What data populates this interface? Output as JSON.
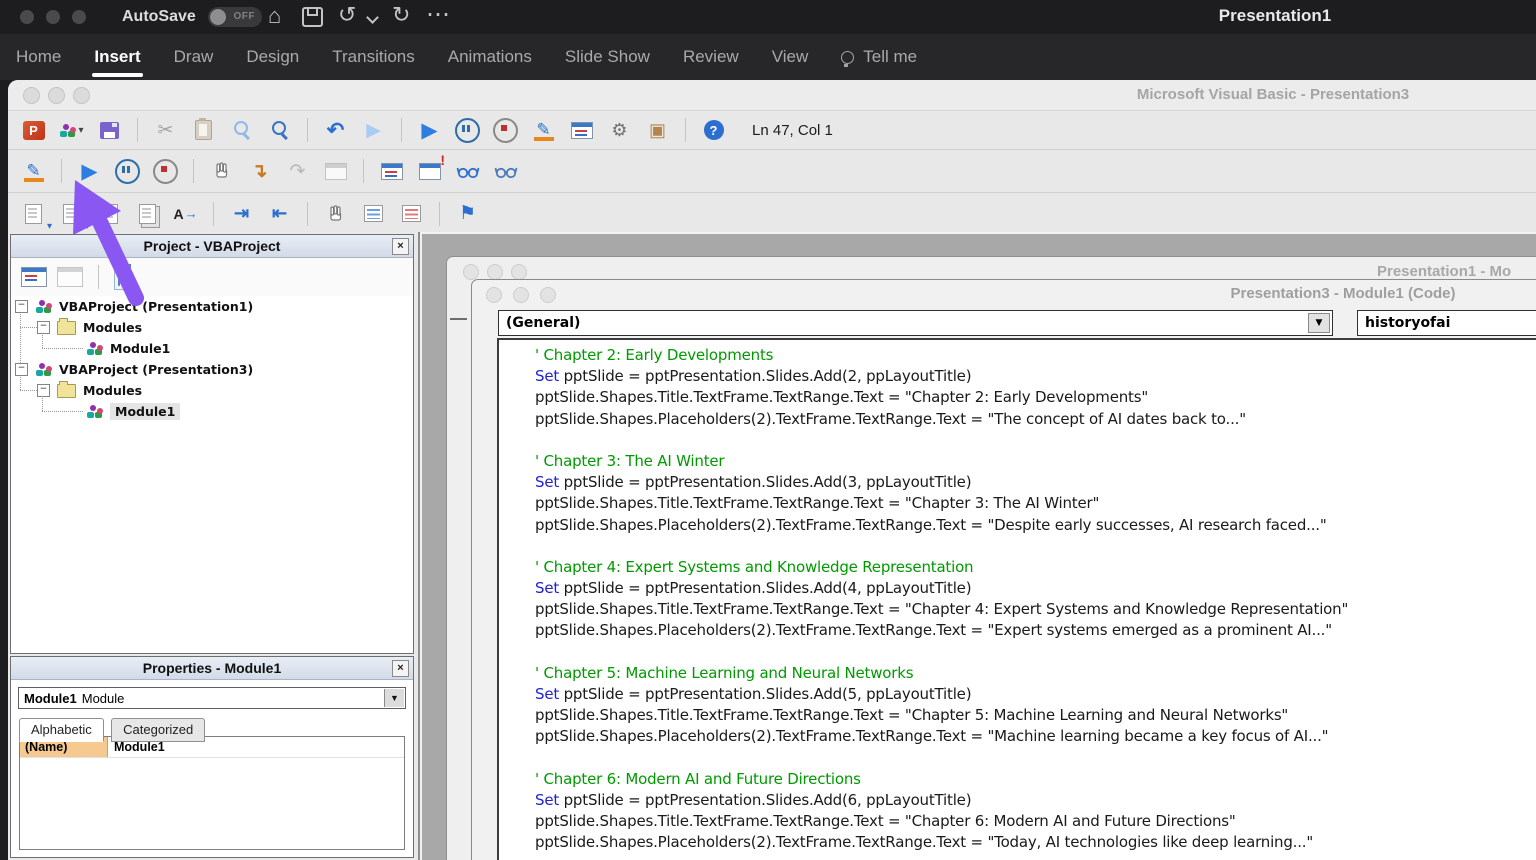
{
  "macos_bar": {
    "autosave_label": "AutoSave",
    "autosave_state": "OFF",
    "window_title": "Presentation1"
  },
  "ribbon": {
    "tabs": [
      {
        "label": "Home"
      },
      {
        "label": "Insert"
      },
      {
        "label": "Draw"
      },
      {
        "label": "Design"
      },
      {
        "label": "Transitions"
      },
      {
        "label": "Animations"
      },
      {
        "label": "Slide Show"
      },
      {
        "label": "Review"
      },
      {
        "label": "View"
      }
    ],
    "active_tab": "Insert",
    "tell_me_label": "Tell me"
  },
  "vba_window": {
    "title": "Microsoft Visual Basic - Presentation3",
    "line_col_indicator": "Ln 47, Col 1"
  },
  "project_panel": {
    "title": "Project - VBAProject",
    "tree": [
      {
        "label": "VBAProject (Presentation1)",
        "type": "project",
        "level": 0,
        "expanded": true
      },
      {
        "label": "Modules",
        "type": "folder",
        "level": 1,
        "expanded": true
      },
      {
        "label": "Module1",
        "type": "module",
        "level": 2
      },
      {
        "label": "VBAProject (Presentation3)",
        "type": "project",
        "level": 0,
        "expanded": true
      },
      {
        "label": "Modules",
        "type": "folder",
        "level": 1,
        "expanded": true
      },
      {
        "label": "Module1",
        "type": "module",
        "level": 2,
        "selected": true
      }
    ]
  },
  "properties_panel": {
    "title": "Properties - Module1",
    "selected_object": "Module1",
    "selected_object_type": "Module",
    "tabs": [
      {
        "label": "Alphabetic",
        "active": true
      },
      {
        "label": "Categorized",
        "active": false
      }
    ],
    "rows": [
      {
        "key": "(Name)",
        "value": "Module1"
      }
    ]
  },
  "code_window": {
    "back_window_title": "Presentation1 - Mo",
    "front_window_title": "Presentation3 - Module1 (Code)",
    "object_dropdown": "(General)",
    "procedure_dropdown": "historyofai"
  },
  "code": {
    "keyword": "Set",
    "blocks": [
      {
        "comment": "' Chapter 2: Early Developments",
        "set_rest": " pptSlide = pptPresentation.Slides.Add(2, ppLayoutTitle)",
        "title_line": "pptSlide.Shapes.Title.TextFrame.TextRange.Text = \"Chapter 2: Early Developments\"",
        "body_line": "pptSlide.Shapes.Placeholders(2).TextFrame.TextRange.Text = \"The concept of AI dates back to...\""
      },
      {
        "comment": "' Chapter 3: The AI Winter",
        "set_rest": " pptSlide = pptPresentation.Slides.Add(3, ppLayoutTitle)",
        "title_line": "pptSlide.Shapes.Title.TextFrame.TextRange.Text = \"Chapter 3: The AI Winter\"",
        "body_line": "pptSlide.Shapes.Placeholders(2).TextFrame.TextRange.Text = \"Despite early successes, AI research faced...\""
      },
      {
        "comment": "' Chapter 4: Expert Systems and Knowledge Representation",
        "set_rest": " pptSlide = pptPresentation.Slides.Add(4, ppLayoutTitle)",
        "title_line": "pptSlide.Shapes.Title.TextFrame.TextRange.Text = \"Chapter 4: Expert Systems and Knowledge Representation\"",
        "body_line": "pptSlide.Shapes.Placeholders(2).TextFrame.TextRange.Text = \"Expert systems emerged as a prominent AI...\""
      },
      {
        "comment": "' Chapter 5: Machine Learning and Neural Networks",
        "set_rest": " pptSlide = pptPresentation.Slides.Add(5, ppLayoutTitle)",
        "title_line": "pptSlide.Shapes.Title.TextFrame.TextRange.Text = \"Chapter 5: Machine Learning and Neural Networks\"",
        "body_line": "pptSlide.Shapes.Placeholders(2).TextFrame.TextRange.Text = \"Machine learning became a key focus of AI...\""
      },
      {
        "comment": "' Chapter 6: Modern AI and Future Directions",
        "set_rest": " pptSlide = pptPresentation.Slides.Add(6, ppLayoutTitle)",
        "title_line": "pptSlide.Shapes.Title.TextFrame.TextRange.Text = \"Chapter 6: Modern AI and Future Directions\"",
        "body_line": "pptSlide.Shapes.Placeholders(2).TextFrame.TextRange.Text = \"Today, AI technologies like deep learning...\""
      }
    ]
  },
  "annotation_arrow": {
    "color": "#8a57f2"
  },
  "colors": {
    "comment_green": "#009a00",
    "keyword_blue": "#2222cc",
    "run_blue": "#2e7de0",
    "accent_blue": "#2d6fd1"
  },
  "icons": {
    "home": "⌂",
    "undo_mac": "↺",
    "redo_mac": "↻",
    "ellipsis": "⋯",
    "cut": "✂",
    "undo": "↶",
    "redo_ghost": "▶",
    "run": "▶",
    "pencil": "✎",
    "gear": "⚙",
    "toolbox": "▣",
    "help": "?",
    "dropdown_arrow": "▼",
    "caret_small": "▾",
    "minus": "−",
    "close": "×",
    "step_into": "↴",
    "step_over": "↷",
    "indent": "⇥",
    "outdent": "⇤",
    "flag": "⚑",
    "complete_a": "A",
    "complete_arrow": "→",
    "exclamation": "!"
  }
}
